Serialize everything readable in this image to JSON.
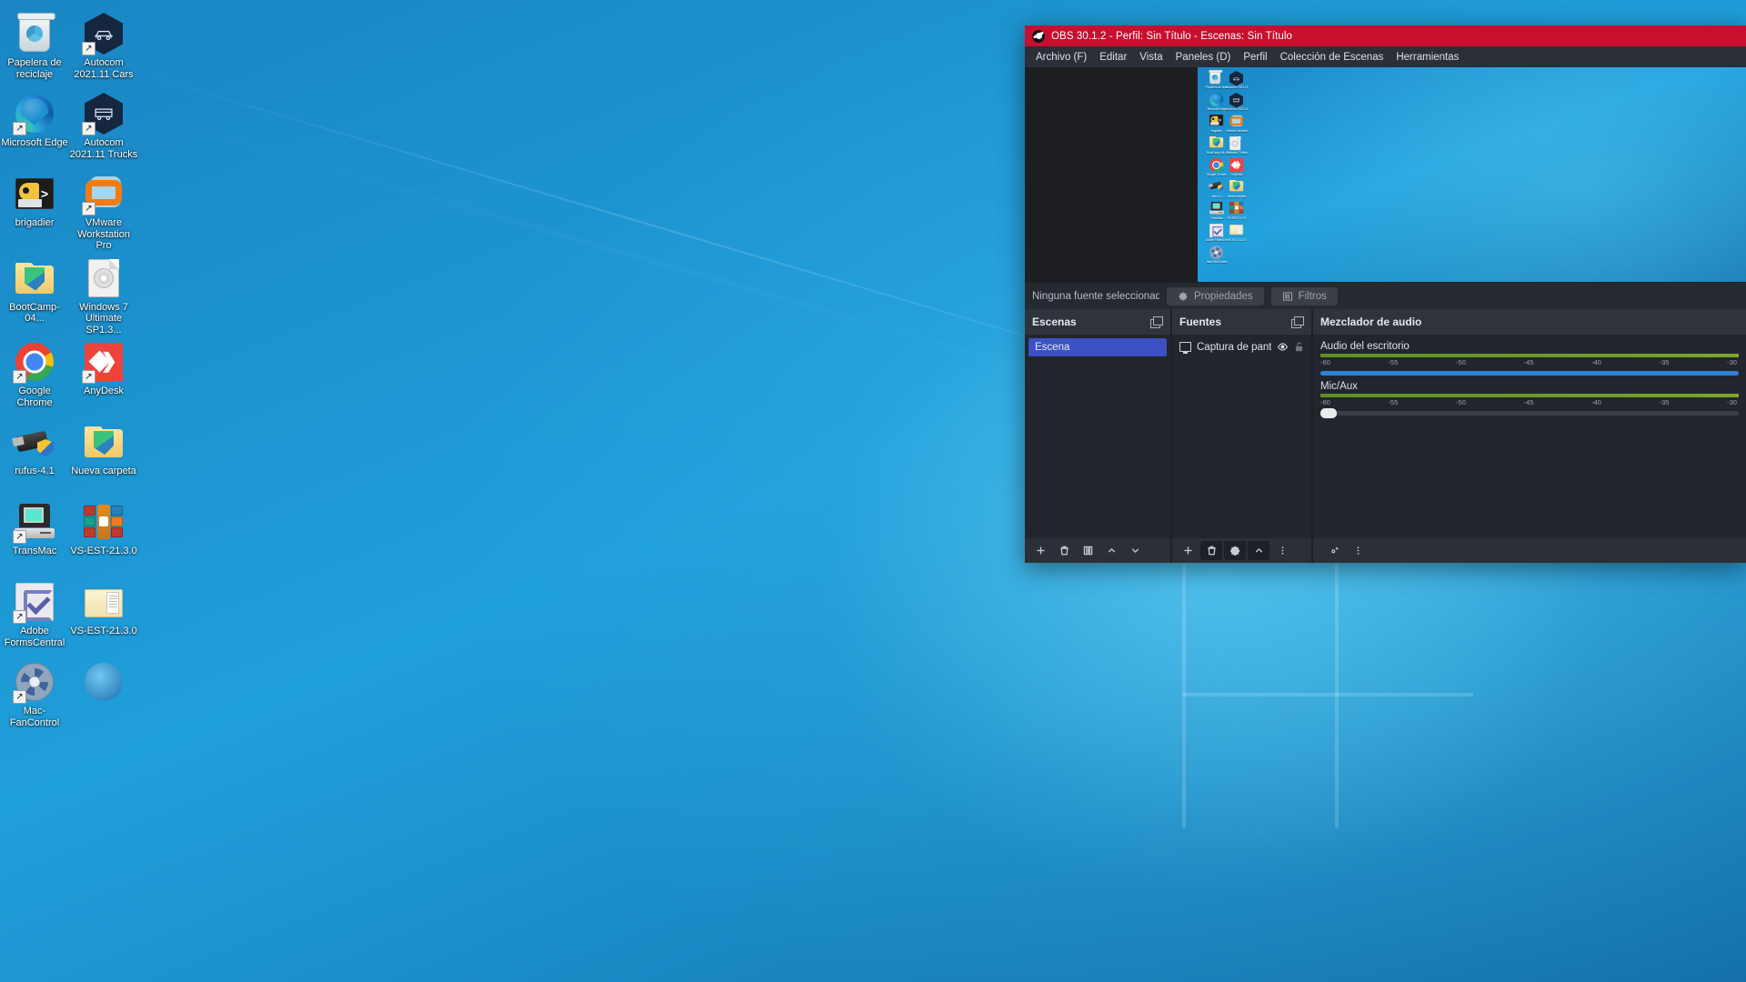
{
  "desktop": {
    "icons": [
      {
        "label": "Papelera de reciclaje",
        "art": "bin",
        "shortcut": false
      },
      {
        "label": "Autocom 2021.11 Cars",
        "art": "hex-car",
        "shortcut": true
      },
      {
        "label": "Microsoft Edge",
        "art": "edge",
        "shortcut": true
      },
      {
        "label": "Autocom 2021.11 Trucks",
        "art": "hex-truck",
        "shortcut": true
      },
      {
        "label": "brigadier",
        "art": "brigadier",
        "shortcut": false
      },
      {
        "label": "VMware Workstation Pro",
        "art": "vmware",
        "shortcut": true
      },
      {
        "label": "BootCamp-04...",
        "art": "folder-green",
        "shortcut": false
      },
      {
        "label": "Windows 7 Ultimate SP1.3...",
        "art": "disc-doc",
        "shortcut": false
      },
      {
        "label": "Google Chrome",
        "art": "chrome",
        "shortcut": true
      },
      {
        "label": "AnyDesk",
        "art": "anydesk",
        "shortcut": true
      },
      {
        "label": "rufus-4.1",
        "art": "rufus",
        "shortcut": false
      },
      {
        "label": "Nueva carpeta",
        "art": "folder-green",
        "shortcut": false
      },
      {
        "label": "TransMac",
        "art": "transmac",
        "shortcut": true
      },
      {
        "label": "VS-EST-21.3.0",
        "art": "winrar",
        "shortcut": false
      },
      {
        "label": "Adobe FormsCentral",
        "art": "adobe",
        "shortcut": true
      },
      {
        "label": "VS-EST-21.3.0",
        "art": "folder-docs",
        "shortcut": false
      },
      {
        "label": "Mac-FanControl",
        "art": "fan",
        "shortcut": true
      },
      {
        "label": "",
        "art": "blue-orb",
        "shortcut": false
      }
    ]
  },
  "obs": {
    "title": "OBS 30.1.2 - Perfil: Sin Título - Escenas: Sin Título",
    "menu": [
      "Archivo (F)",
      "Editar",
      "Vista",
      "Paneles (D)",
      "Perfil",
      "Colección de Escenas",
      "Herramientas"
    ],
    "source_toolbar": {
      "status": "Ninguna fuente seleccionada",
      "properties_label": "Propiedades",
      "filters_label": "Filtros"
    },
    "scenes_panel": {
      "title": "Escenas",
      "items": [
        {
          "label": "Escena",
          "selected": true
        }
      ]
    },
    "sources_panel": {
      "title": "Fuentes",
      "items": [
        {
          "label": "Captura de pantalla",
          "visible": true,
          "locked": false
        }
      ]
    },
    "mixer_panel": {
      "title": "Mezclador de audio",
      "ticks": [
        "-60",
        "-55",
        "-50",
        "-45",
        "-40",
        "-35",
        "-30"
      ],
      "tracks": [
        {
          "name": "Audio del escritorio",
          "volume_percent": 100,
          "handle_percent": 100
        },
        {
          "name": "Mic/Aux",
          "volume_percent": 0,
          "handle_percent": 2
        }
      ]
    },
    "preview": {
      "mini_icons": [
        "Papelera de reciclaje",
        "Autocom 2021.11 Cars",
        "Microsoft Edge",
        "Autocom 2021.11 Trucks",
        "brigadier",
        "VMware Workstation Pro",
        "BootCamp-04...",
        "Windows 7 Ultimate",
        "Google Chrome",
        "AnyDesk",
        "rufus-4.1",
        "Nueva carpeta",
        "TransMac",
        "VS-EST-21.3.0",
        "Adobe FormsCentral",
        "VS-EST-21.3.0",
        "Mac-FanControl"
      ]
    },
    "colors": {
      "titlebar": "#c8102e",
      "selection": "#3b51c4",
      "meter_green": "#6f9e28",
      "slider_blue": "#2f81d4"
    }
  }
}
